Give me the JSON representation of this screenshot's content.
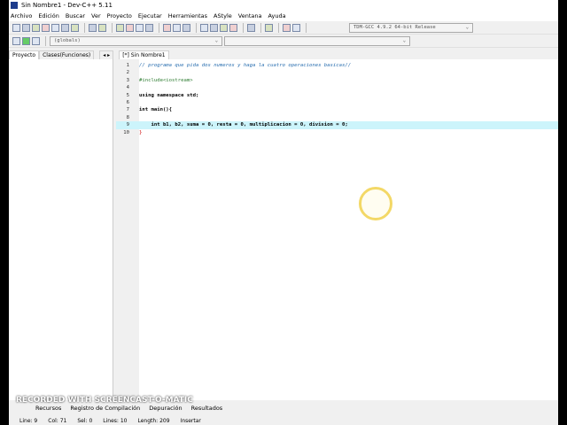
{
  "window": {
    "title": "Sin Nombre1 - Dev-C++ 5.11"
  },
  "menu": [
    "Archivo",
    "Edición",
    "Buscar",
    "Ver",
    "Proyecto",
    "Ejecutar",
    "Herramientas",
    "AStyle",
    "Ventana",
    "Ayuda"
  ],
  "toolbar": {
    "compiler": "TDM-GCC 4.9.2 64-bit Release",
    "scope": "(globals)"
  },
  "left_tabs": [
    "Proyecto",
    "Clases(Funciones)"
  ],
  "editor_tab": "[*] Sin Nombre1",
  "code": [
    {
      "n": "1",
      "text": "// programa que pida dos numeros y haga la cuatro operaciones basicas//",
      "cls": "cm"
    },
    {
      "n": "2",
      "text": "",
      "cls": ""
    },
    {
      "n": "3",
      "text": "#include<iostream>",
      "cls": "pp"
    },
    {
      "n": "4",
      "text": "",
      "cls": ""
    },
    {
      "n": "5",
      "text": "using namespace std;",
      "cls": "kw"
    },
    {
      "n": "6",
      "text": "",
      "cls": ""
    },
    {
      "n": "7",
      "text": "int main(){",
      "cls": "kw"
    },
    {
      "n": "8",
      "text": "",
      "cls": ""
    },
    {
      "n": "9",
      "text": "    int b1, b2, suma = 0, resta = 0, multiplicacion = 0, division = 0;",
      "cls": "kw"
    },
    {
      "n": "10",
      "text": "}",
      "cls": "br"
    }
  ],
  "bottom_tabs": [
    "Recursos",
    "Registro de Compilación",
    "Depuración",
    "Resultados"
  ],
  "status": {
    "line": "Line:   9",
    "col": "Col:   71",
    "sel": "Sel:   0",
    "lines": "Lines:   10",
    "length": "Length:   209",
    "mode": "Insertar"
  },
  "watermark": "RECORDED WITH SCREENCAST-O-MATIC"
}
